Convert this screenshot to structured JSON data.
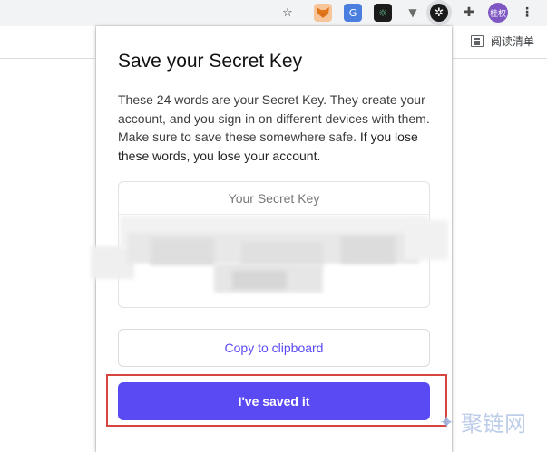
{
  "browser": {
    "reading_list_label": "阅读清单",
    "profile_initials": "桂权",
    "icons": [
      "star-icon",
      "metamask-fox-icon",
      "translate-icon",
      "extension-icon",
      "vpn-icon",
      "wallet-icon",
      "puzzle-icon",
      "avatar",
      "more-vert-icon"
    ]
  },
  "popup": {
    "title": "Save your Secret Key",
    "description": "These 24 words are your Secret Key. They create your account, and you sign in on different devices with them. Make sure to save these somewhere safe.",
    "description_emphasis": "If you lose these words, you lose your account.",
    "secret_key_label": "Your Secret Key",
    "copy_button_label": "Copy to clipboard",
    "saved_button_label": "I've saved it"
  },
  "watermark": "聚链网",
  "colors": {
    "accent": "#5a4af4",
    "highlight": "#d6453f"
  }
}
